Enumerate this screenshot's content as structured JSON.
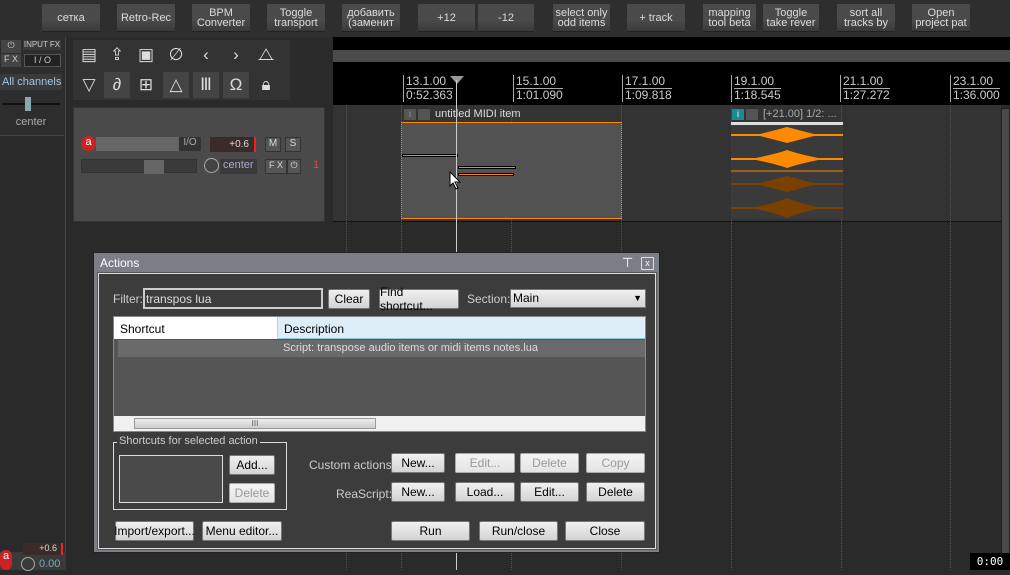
{
  "toolbar": {
    "buttons": [
      "сетка",
      "Retro-Rec",
      "BPM\nConverter",
      "Toggle\ntransport",
      "добавить\n(заменит",
      "+12",
      "-12",
      "select only\nodd items",
      "+ track",
      "mapping\ntool beta",
      "Toggle\ntake rever",
      "sort all\ntracks by",
      "Open\nproject pat"
    ]
  },
  "mixer": {
    "fx": "F X",
    "input_fx": "INPUT FX",
    "io": "I / O",
    "channels": "All channels",
    "pan": "center",
    "volume": "+0.6",
    "pan_value": "0.00"
  },
  "ruler": [
    {
      "bar": "13.1.00",
      "time": "0:52.363"
    },
    {
      "bar": "15.1.00",
      "time": "1:01.090"
    },
    {
      "bar": "17.1.00",
      "time": "1:09.818"
    },
    {
      "bar": "19.1.00",
      "time": "1:18.545"
    },
    {
      "bar": "21.1.00",
      "time": "1:27.272"
    },
    {
      "bar": "23.1.00",
      "time": "1:36.000"
    }
  ],
  "track": {
    "io": "I/O",
    "volume": "+0.6",
    "mute": "M",
    "solo": "S",
    "pan": "center",
    "fx": "F X",
    "number": "1"
  },
  "items": {
    "midi": "untitled MIDI item",
    "audio": "[+21.00] 1/2: ..."
  },
  "accent": "#ff8a00",
  "actions": {
    "title": "Actions",
    "filter_label": "Filter:",
    "filter_value": "transpos lua",
    "clear": "Clear",
    "find_shortcut": "Find shortcut...",
    "section_label": "Section:",
    "section_value": "Main",
    "columns": [
      "Shortcut",
      "Description"
    ],
    "rows": [
      {
        "shortcut": "",
        "description": "Script: transpose audio items or midi items notes.lua"
      }
    ],
    "shortcuts_group": "Shortcuts for selected action",
    "add": "Add...",
    "delete": "Delete",
    "custom_label": "Custom actions:",
    "custom": [
      "New...",
      "Edit...",
      "Delete",
      "Copy"
    ],
    "reascript_label": "ReaScript:",
    "reascript": [
      "New...",
      "Load...",
      "Edit...",
      "Delete"
    ],
    "import_export": "Import/export...",
    "menu_editor": "Menu editor...",
    "run": "Run",
    "run_close": "Run/close",
    "close": "Close"
  },
  "clock": "0:00"
}
